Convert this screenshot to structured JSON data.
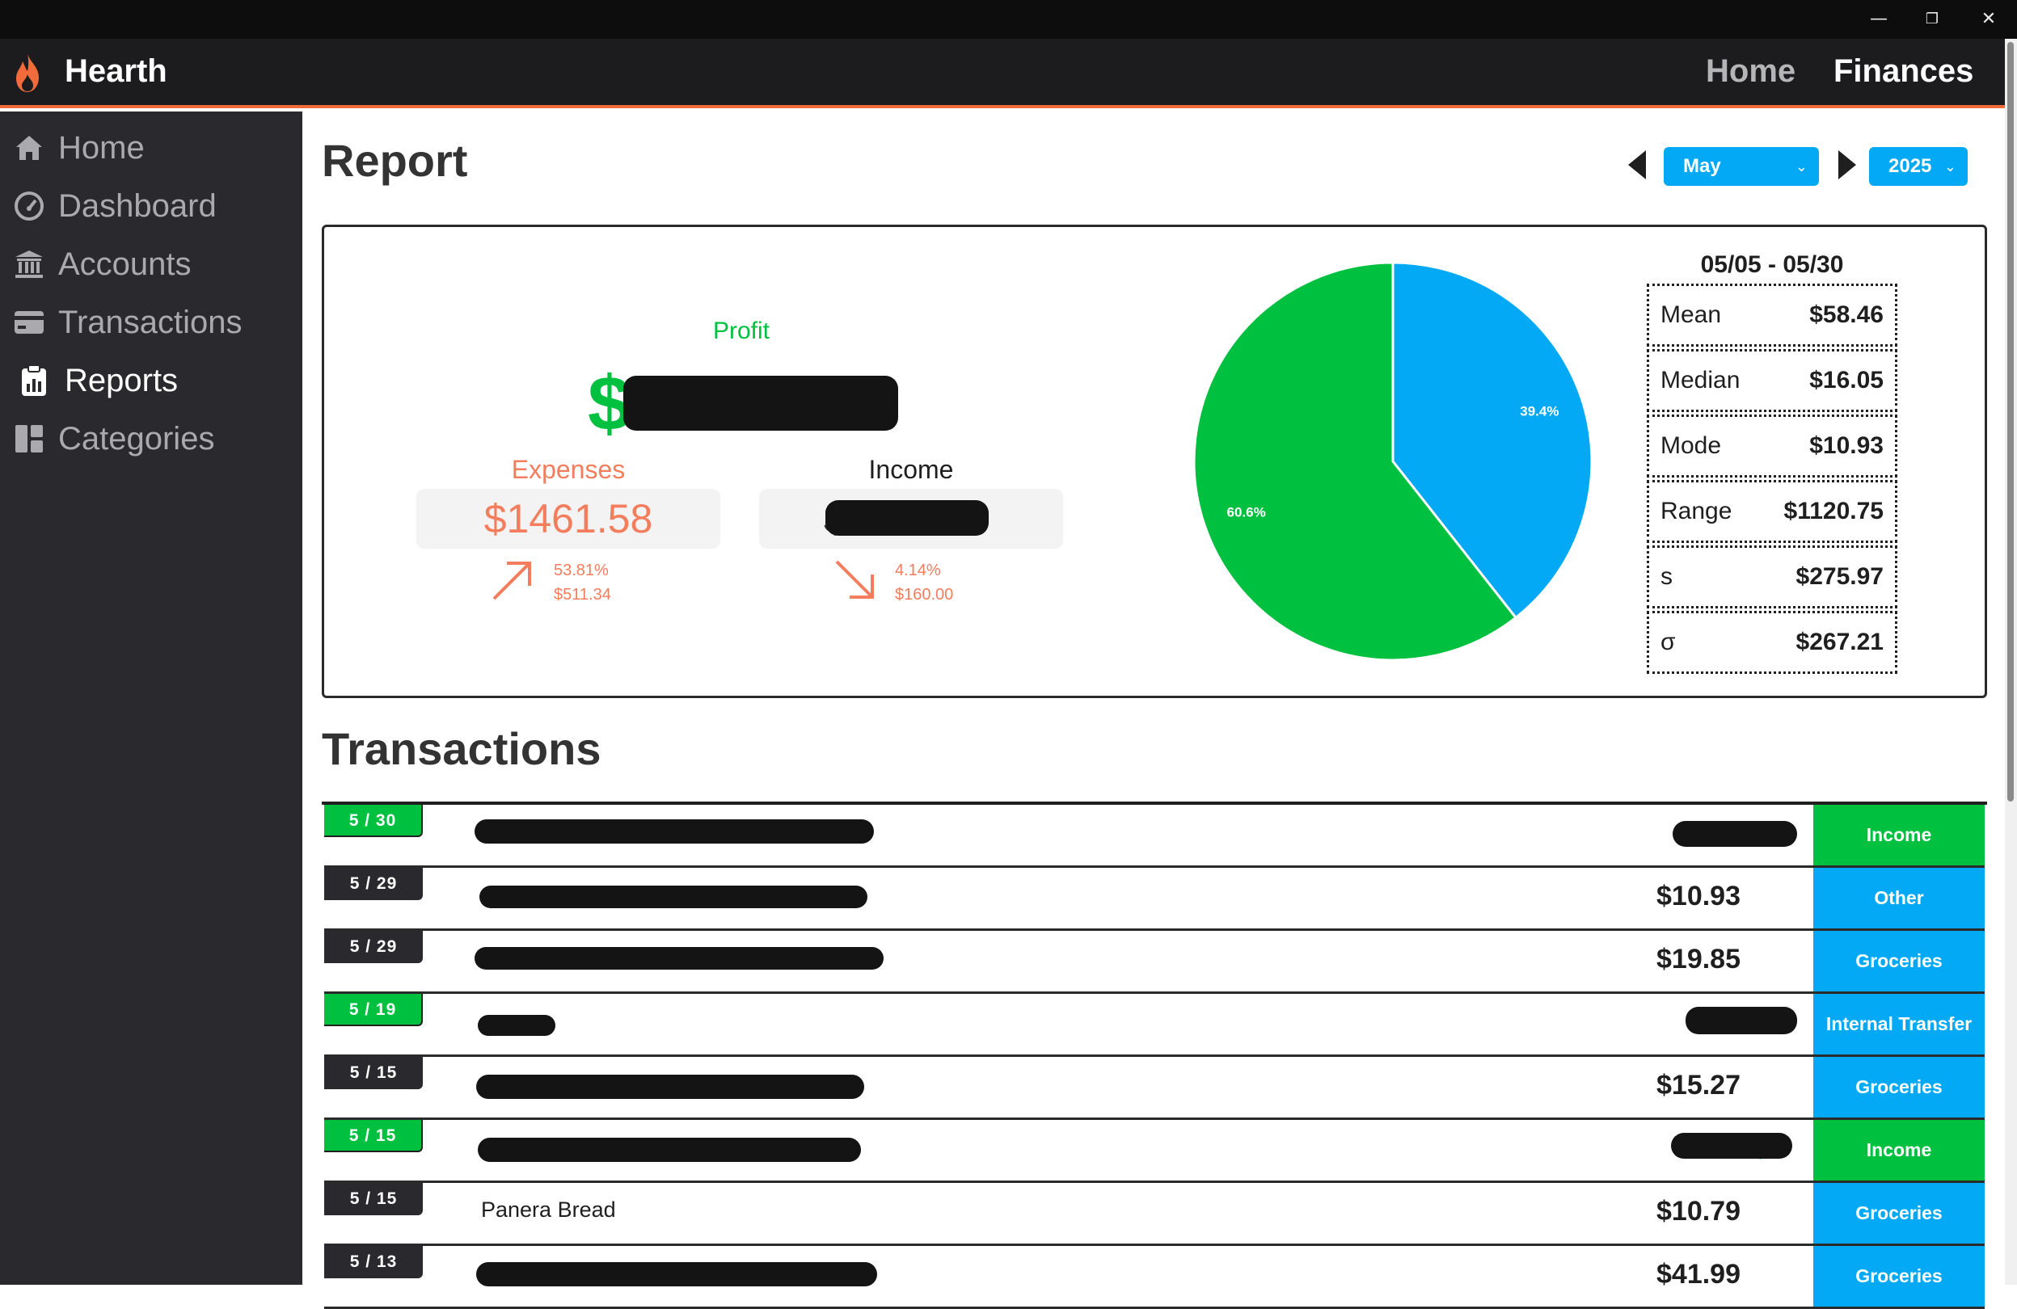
{
  "window": {
    "minimize_glyph": "—",
    "restore_glyph": "❐",
    "close_glyph": "✕"
  },
  "app": {
    "name": "Hearth",
    "accent": "#f26b3a",
    "nav": [
      {
        "label": "Home",
        "active": false
      },
      {
        "label": "Finances",
        "active": true
      }
    ]
  },
  "sidebar": {
    "items": [
      {
        "label": "Home",
        "icon": "home-icon",
        "active": false
      },
      {
        "label": "Dashboard",
        "icon": "gauge-icon",
        "active": false
      },
      {
        "label": "Accounts",
        "icon": "bank-icon",
        "active": false
      },
      {
        "label": "Transactions",
        "icon": "credit-card-icon",
        "active": false
      },
      {
        "label": "Reports",
        "icon": "clipboard-chart-icon",
        "active": true
      },
      {
        "label": "Categories",
        "icon": "dashboard-layout-icon",
        "active": false
      }
    ]
  },
  "report": {
    "title": "Report",
    "month": "May",
    "year": "2025",
    "profit": {
      "label": "Profit",
      "value": "$"
    },
    "expenses": {
      "label": "Expenses",
      "value": "$1461.58",
      "delta_pct": "53.81%",
      "delta_amt": "$511.34",
      "color": "#f37d5c"
    },
    "income": {
      "label": "Income",
      "value": "$",
      "delta_pct": "4.14%",
      "delta_amt": "$160.00"
    },
    "colors": {
      "income": "#00c040",
      "other": "#03a9f4"
    }
  },
  "chart_data": {
    "type": "pie",
    "categories": [
      "",
      ""
    ],
    "values": [
      39.4,
      60.6
    ],
    "labels": [
      "39.4%",
      "60.6%"
    ],
    "colors": [
      "#03a9f4",
      "#00c040"
    ]
  },
  "stats": {
    "range": "05/05 - 05/30",
    "rows": [
      {
        "k": "Mean",
        "v": "$58.46"
      },
      {
        "k": "Median",
        "v": "$16.05"
      },
      {
        "k": "Mode",
        "v": "$10.93"
      },
      {
        "k": "Range",
        "v": "$1120.75"
      },
      {
        "k": "s",
        "v": "$275.97"
      },
      {
        "k": "σ",
        "v": "$267.21"
      }
    ]
  },
  "transactions": {
    "title": "Transactions",
    "rows": [
      {
        "date": "5 / 30",
        "desc": "",
        "amount": "$",
        "category": "Income",
        "type": "income"
      },
      {
        "date": "5 / 29",
        "desc": "",
        "amount": "$10.93",
        "category": "Other",
        "type": "expense"
      },
      {
        "date": "5 / 29",
        "desc": "",
        "amount": "$19.85",
        "category": "Groceries",
        "type": "expense"
      },
      {
        "date": "5 / 19",
        "desc": "",
        "amount": "$",
        "category": "Internal Transfer",
        "type": "income"
      },
      {
        "date": "5 / 15",
        "desc": "",
        "amount": "$15.27",
        "category": "Groceries",
        "type": "expense"
      },
      {
        "date": "5 / 15",
        "desc": "",
        "amount": "$",
        "category": "Income",
        "type": "income"
      },
      {
        "date": "5 / 15",
        "desc": "Panera Bread",
        "amount": "$10.79",
        "category": "Groceries",
        "type": "expense"
      },
      {
        "date": "5 / 13",
        "desc": "",
        "amount": "$41.99",
        "category": "Groceries",
        "type": "expense"
      }
    ]
  }
}
